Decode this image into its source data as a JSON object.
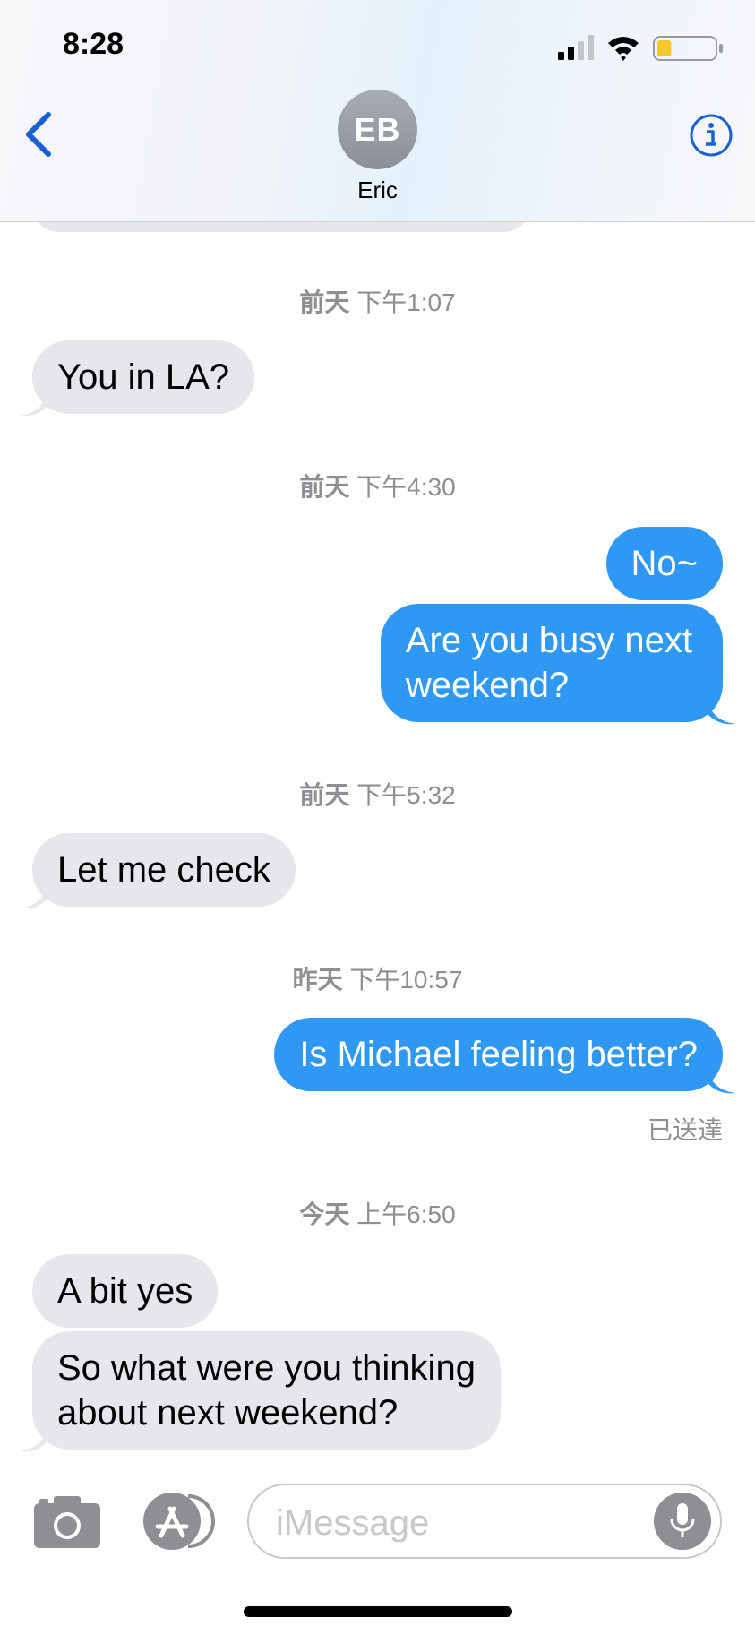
{
  "status_bar": {
    "time": "8:28",
    "battery_level": 0.25
  },
  "header": {
    "avatar_initials": "EB",
    "contact_name": "Eric"
  },
  "messages": [
    {
      "type": "timestamp",
      "day": "前天",
      "time": "下午1:07"
    },
    {
      "type": "received",
      "text": "You in LA?"
    },
    {
      "type": "timestamp",
      "day": "前天",
      "time": "下午4:30"
    },
    {
      "type": "sent",
      "text": "No~"
    },
    {
      "type": "sent",
      "lines": [
        "Are you busy next",
        "weekend?"
      ]
    },
    {
      "type": "timestamp",
      "day": "前天",
      "time": "下午5:32"
    },
    {
      "type": "received",
      "text": "Let me check"
    },
    {
      "type": "timestamp",
      "day": "昨天",
      "time": "下午10:57"
    },
    {
      "type": "sent",
      "text": "Is Michael feeling better?"
    },
    {
      "type": "status",
      "text": "已送達"
    },
    {
      "type": "timestamp",
      "day": "今天",
      "time": "上午6:50"
    },
    {
      "type": "received",
      "text": "A bit yes"
    },
    {
      "type": "received",
      "lines": [
        "So what were you thinking",
        "about next weekend?"
      ]
    }
  ],
  "input": {
    "placeholder": "iMessage"
  },
  "colors": {
    "sent_bubble": "#2e98f4",
    "received_bubble": "#e6e6eb",
    "accent": "#1a5fd6"
  },
  "icons": [
    "back-chevron-icon",
    "info-icon",
    "camera-icon",
    "app-store-icon",
    "microphone-icon",
    "signal-icon",
    "wifi-icon",
    "battery-icon"
  ]
}
